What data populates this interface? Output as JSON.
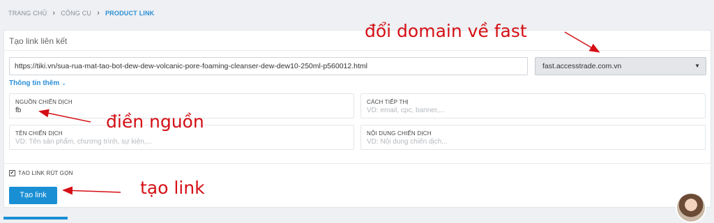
{
  "breadcrumb": {
    "home": "TRANG CHỦ",
    "sep1": "›",
    "tools": "CÔNG CỤ",
    "sep2": "›",
    "current": "PRODUCT LINK"
  },
  "card": {
    "title": "Tạo link liên kết",
    "url_value": "https://tiki.vn/sua-rua-mat-tao-bot-dew-dew-volcanic-pore-foaming-cleanser-dew-dew10-250ml-p560012.html",
    "domain_selected": "fast.accesstrade.com.vn",
    "domain_caret": "▼",
    "more_label": "Thông tin thêm",
    "more_chevron": "⌄"
  },
  "fields": {
    "campaign_source": {
      "label": "NGUỒN CHIẾN DỊCH",
      "value": "fb"
    },
    "marketing_method": {
      "label": "CÁCH TIẾP THỊ",
      "placeholder": "VD: email, cpc, banner,..."
    },
    "campaign_name": {
      "label": "TÊN CHIẾN DỊCH",
      "placeholder": "VD: Tên sản phẩm, chương trình, sự kiện,..."
    },
    "campaign_content": {
      "label": "NỘI DUNG CHIẾN DỊCH",
      "placeholder": "VD: Nội dung chiến dịch..."
    }
  },
  "shorten": {
    "label": "TẠO LINK RÚT GỌN",
    "checked": true,
    "mark": "✔"
  },
  "create_button": "Tạo link",
  "annotations": {
    "domain": "đổi domain về fast",
    "source": "điền nguồn",
    "create": "tạo link",
    "color": "#d40f15"
  },
  "colors": {
    "accent": "#1a8fd4",
    "link": "#2a8fd6"
  }
}
